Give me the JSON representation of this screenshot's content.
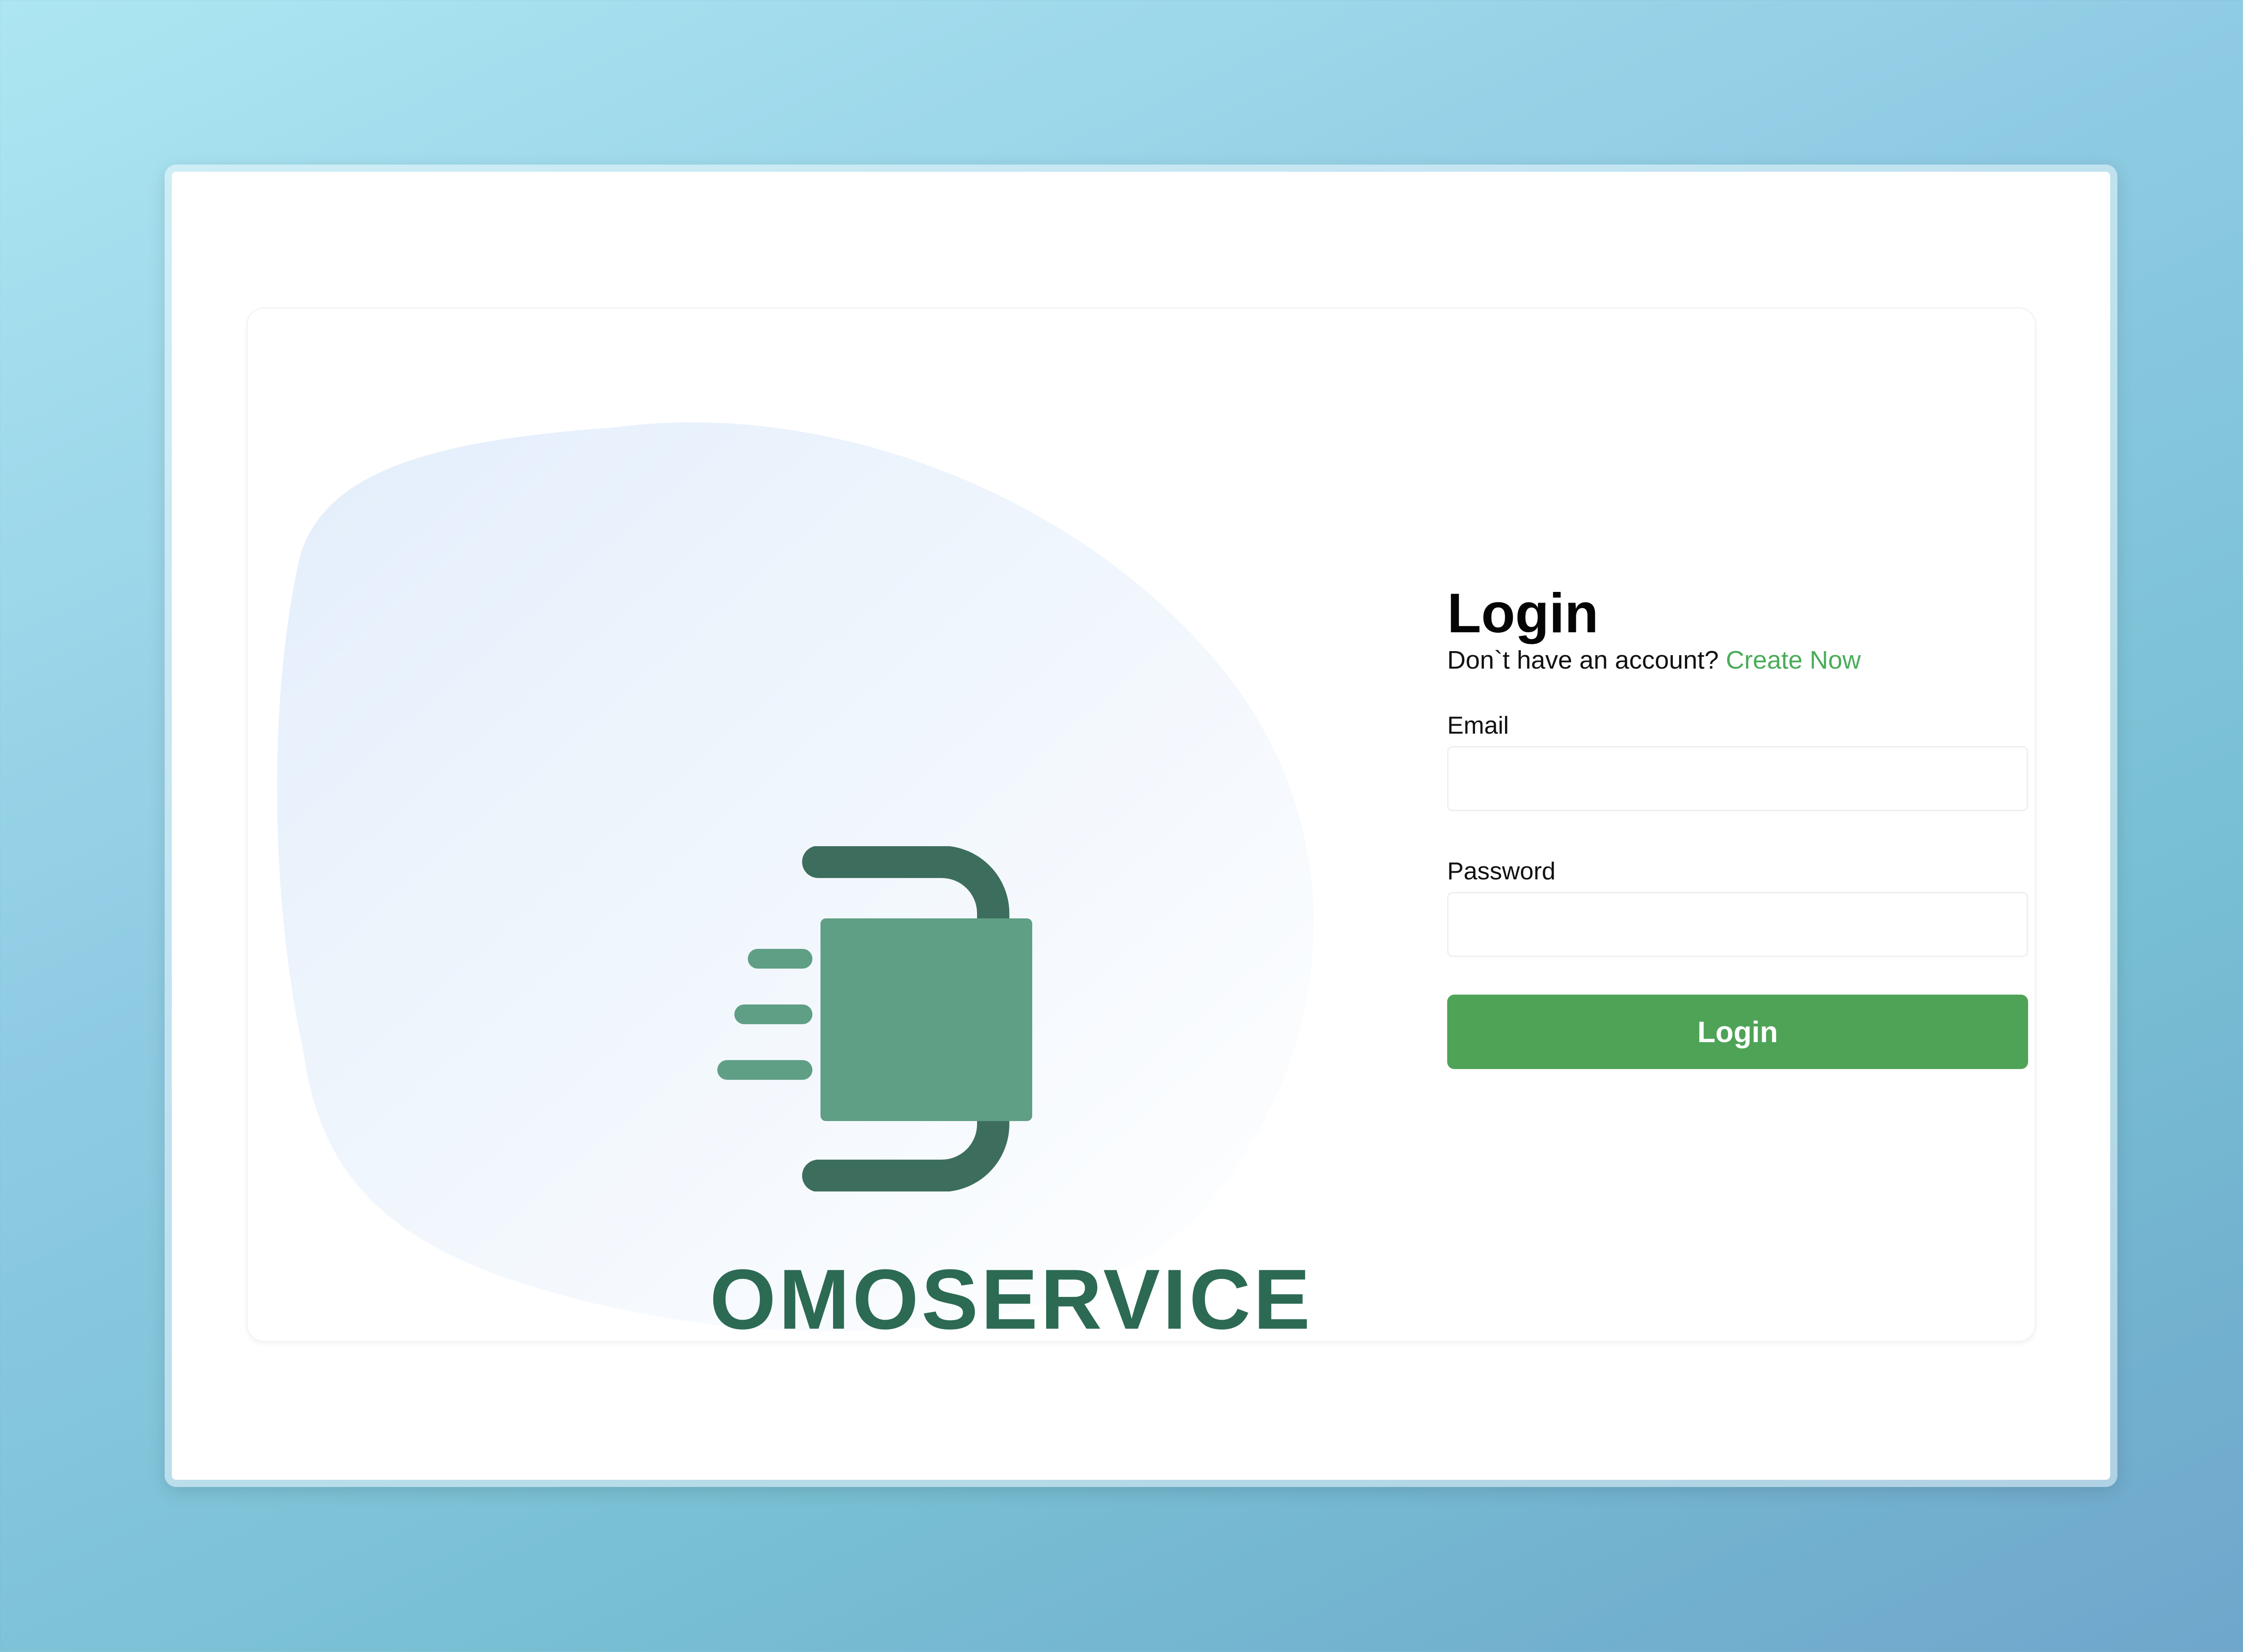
{
  "brand": {
    "name": "OMOSERVICE",
    "logo_icon": "omoservice-logo-icon",
    "colors": {
      "dark_green": "#3d6e5d",
      "light_green": "#5f9f85",
      "text_green": "#2c6a53"
    }
  },
  "login_form": {
    "title": "Login",
    "signup_prompt": "Don`t have an account?",
    "signup_link": "Create Now",
    "email": {
      "label": "Email",
      "value": "",
      "placeholder": ""
    },
    "password": {
      "label": "Password",
      "value": "",
      "placeholder": ""
    },
    "submit_label": "Login"
  },
  "colors": {
    "accent": "#4fa357",
    "link": "#4aad59",
    "blob": "#e6f0fc"
  }
}
